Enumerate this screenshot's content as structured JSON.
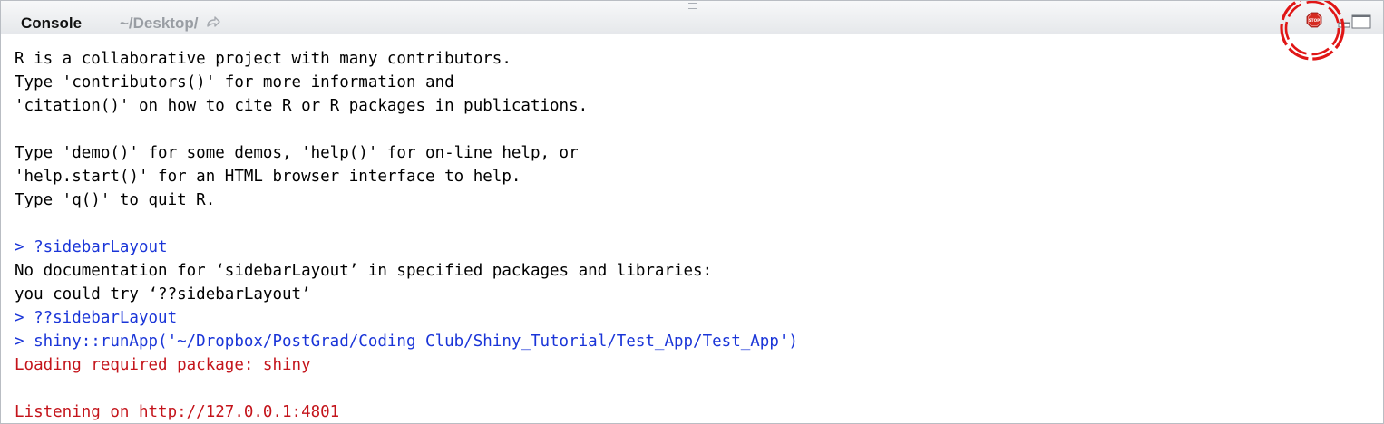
{
  "toolbar": {
    "title": "Console",
    "path": "~/Desktop/",
    "icons": {
      "goto": "goto-directory-icon",
      "stop": "stop-icon",
      "minimize": "minimize-icon",
      "maximize": "maximize-icon"
    },
    "stop_label": "STOP"
  },
  "colors": {
    "input": "#1a35d8",
    "message": "#c4141b",
    "output": "#000000",
    "highlight": "#e01616"
  },
  "console": {
    "lines": [
      {
        "type": "output",
        "text": "R is a collaborative project with many contributors."
      },
      {
        "type": "output",
        "text": "Type 'contributors()' for more information and"
      },
      {
        "type": "output",
        "text": "'citation()' on how to cite R or R packages in publications."
      },
      {
        "type": "output",
        "text": ""
      },
      {
        "type": "output",
        "text": "Type 'demo()' for some demos, 'help()' for on-line help, or"
      },
      {
        "type": "output",
        "text": "'help.start()' for an HTML browser interface to help."
      },
      {
        "type": "output",
        "text": "Type 'q()' to quit R."
      },
      {
        "type": "output",
        "text": ""
      },
      {
        "type": "input",
        "text": "> ?sidebarLayout"
      },
      {
        "type": "output",
        "text": "No documentation for ‘sidebarLayout’ in specified packages and libraries:"
      },
      {
        "type": "output",
        "text": "you could try ‘??sidebarLayout’"
      },
      {
        "type": "input",
        "text": "> ??sidebarLayout"
      },
      {
        "type": "input",
        "text": "> shiny::runApp('~/Dropbox/PostGrad/Coding Club/Shiny_Tutorial/Test_App/Test_App')"
      },
      {
        "type": "message",
        "text": "Loading required package: shiny"
      },
      {
        "type": "message",
        "text": ""
      },
      {
        "type": "message",
        "text": "Listening on http://127.0.0.1:4801"
      }
    ]
  }
}
